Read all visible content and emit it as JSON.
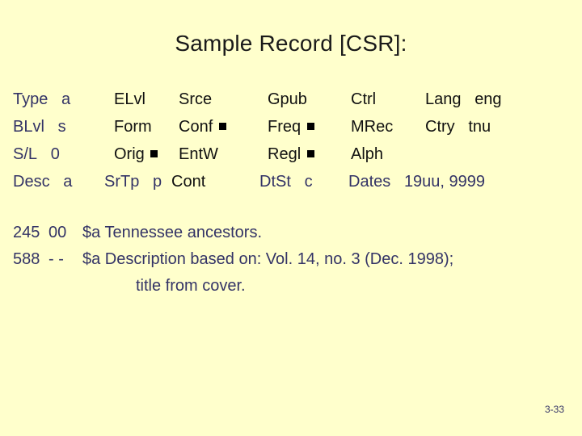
{
  "slide": {
    "title": "Sample Record [CSR]:",
    "page_number": "3-33",
    "colors": {
      "background": "#ffffcc",
      "navy_text": "#333366",
      "dark_text": "#111111",
      "marker": "#000000"
    }
  },
  "fixed_fields": {
    "rows": [
      {
        "cells": [
          {
            "label": "Type",
            "value": "a",
            "tone": "navy",
            "marker": false
          },
          {
            "label": "ELvl",
            "value": "",
            "tone": "dark",
            "marker": false
          },
          {
            "label": "Srce",
            "value": "",
            "tone": "dark",
            "marker": false
          },
          {
            "label": "Gpub",
            "value": "",
            "tone": "dark",
            "marker": false
          },
          {
            "label": "Ctrl",
            "value": "",
            "tone": "dark",
            "marker": false
          },
          {
            "label": "Lang",
            "value": "eng",
            "tone": "dark",
            "marker": false
          }
        ]
      },
      {
        "cells": [
          {
            "label": "BLvl",
            "value": "s",
            "tone": "navy",
            "marker": false
          },
          {
            "label": "Form",
            "value": "",
            "tone": "dark",
            "marker": false
          },
          {
            "label": "Conf",
            "value": "",
            "tone": "dark",
            "marker": true
          },
          {
            "label": "Freq",
            "value": "",
            "tone": "dark",
            "marker": true
          },
          {
            "label": "MRec",
            "value": "",
            "tone": "dark",
            "marker": false
          },
          {
            "label": "Ctry",
            "value": "tnu",
            "tone": "dark",
            "marker": false
          }
        ]
      },
      {
        "cells": [
          {
            "label": "S/L",
            "value": "0",
            "tone": "navy",
            "marker": false
          },
          {
            "label": "Orig",
            "value": "",
            "tone": "dark",
            "marker": true
          },
          {
            "label": "EntW",
            "value": "",
            "tone": "dark",
            "marker": false
          },
          {
            "label": "Regl",
            "value": "",
            "tone": "dark",
            "marker": true
          },
          {
            "label": "Alph",
            "value": "",
            "tone": "dark",
            "marker": false
          }
        ]
      },
      {
        "cells": [
          {
            "label": "Desc",
            "value": "a",
            "tone": "navy",
            "marker": false
          },
          {
            "label": "SrTp",
            "value": "p",
            "tone": "navy",
            "marker": false
          },
          {
            "label": "Cont",
            "value": "",
            "tone": "dark",
            "marker": false
          },
          {
            "label": "DtSt",
            "value": "c",
            "tone": "navy",
            "marker": false
          },
          {
            "label": "Dates",
            "value": "19uu, 9999",
            "tone": "navy",
            "marker": false
          }
        ]
      }
    ]
  },
  "marc_fields": {
    "lines": [
      {
        "tag": "245",
        "indicators": "00",
        "text": "$a Tennessee ancestors."
      },
      {
        "tag": "588",
        "indicators": "- -",
        "text": "$a Description based on: Vol. 14, no. 3 (Dec. 1998);"
      }
    ],
    "continuation": "title from cover."
  }
}
